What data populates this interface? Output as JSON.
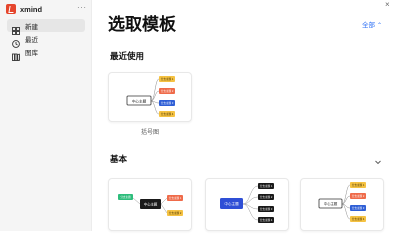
{
  "app": {
    "brand": "xmind",
    "more": "···"
  },
  "sidebar": {
    "items": [
      {
        "label": "新建",
        "icon": "grid-icon",
        "active": true
      },
      {
        "label": "最近",
        "icon": "clock-icon",
        "active": false
      },
      {
        "label": "图库",
        "icon": "books-icon",
        "active": false
      }
    ]
  },
  "window": {
    "close": "×"
  },
  "main": {
    "title": "选取模板",
    "sort": {
      "label": "全部",
      "caret": "⌃"
    },
    "recent": {
      "title": "最近使用",
      "card": {
        "caption": "括号图",
        "root": "中心主题",
        "branches": [
          "分支主题 1",
          "分支主题 2",
          "分支主题 3",
          "分支主题 4"
        ],
        "colors": {
          "root_border": "#333333",
          "branch_1": "#f5c242",
          "branch_2": "#ef6b4a",
          "branch_3": "#2f5fd6",
          "branch_4": "#f5c242"
        }
      }
    },
    "basic": {
      "title": "基本",
      "cards": [
        {
          "root": "中心主题",
          "left": [
            "分支主题"
          ],
          "right": [
            "分支主题 1",
            "分支主题 2"
          ],
          "colors": {
            "root": "#1a1a1a",
            "left": "#2ebd7c",
            "right_1": "#ef6b4a",
            "right_2": "#f5c242"
          }
        },
        {
          "root": "中心主题",
          "branches": [
            "分支主题 1",
            "分支主题 2",
            "分支主题 3",
            "分支主题 4"
          ],
          "colors": {
            "root": "#2f4fd6",
            "branch": "#1a1a1a"
          }
        },
        {
          "root": "中心主题",
          "branches": [
            "分支主题 1",
            "分支主题 2",
            "分支主题 3",
            "分支主题 4"
          ],
          "colors": {
            "root_border": "#333333",
            "branch_1": "#f5c242",
            "branch_2": "#ef6b4a",
            "branch_3": "#2f5fd6",
            "branch_4": "#f5c242"
          }
        }
      ]
    }
  }
}
